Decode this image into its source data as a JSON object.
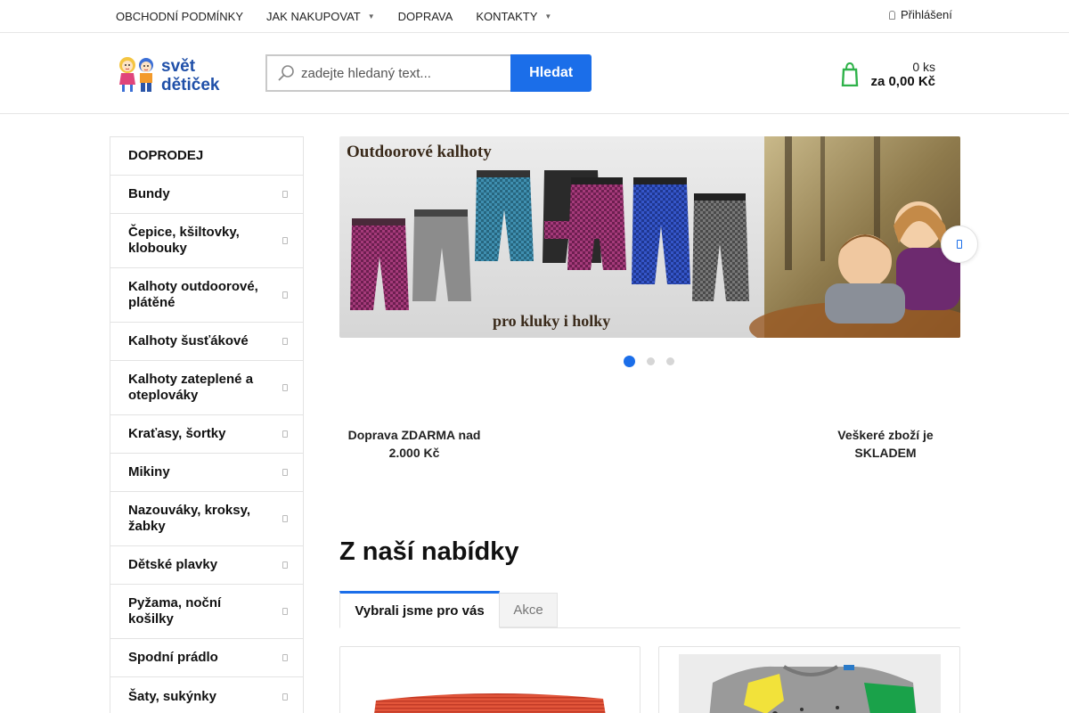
{
  "topnav": {
    "items": [
      {
        "label": "OBCHODNÍ PODMÍNKY",
        "dropdown": false
      },
      {
        "label": "JAK NAKUPOVAT",
        "dropdown": true
      },
      {
        "label": "DOPRAVA",
        "dropdown": false
      },
      {
        "label": "KONTAKTY",
        "dropdown": true
      }
    ],
    "login_label": "Přihlášení"
  },
  "logo": {
    "text_line1": "svět",
    "text_line2": "dětiček"
  },
  "search": {
    "placeholder": "zadejte hledaný text...",
    "button_label": "Hledat"
  },
  "cart": {
    "count": "0 ks",
    "total": "za 0,00 Kč",
    "accent": "#2fb24a"
  },
  "sidebar": {
    "items": [
      {
        "label": "DOPRODEJ"
      },
      {
        "label": "Bundy"
      },
      {
        "label": "Čepice, kšiltovky, klobouky"
      },
      {
        "label": "Kalhoty outdoorové, plátěné"
      },
      {
        "label": "Kalhoty šusťákové"
      },
      {
        "label": "Kalhoty zateplené a oteplováky"
      },
      {
        "label": "Kraťasy, šortky"
      },
      {
        "label": "Mikiny"
      },
      {
        "label": "Nazouváky, kroksy, žabky"
      },
      {
        "label": "Dětské plavky"
      },
      {
        "label": "Pyžama, noční košilky"
      },
      {
        "label": "Spodní prádlo"
      },
      {
        "label": "Šaty, sukýnky"
      }
    ]
  },
  "banner": {
    "title": "Outdoorové kalhoty",
    "subtitle": "pro kluky i holky",
    "slide_count": 3,
    "active_slide": 1
  },
  "benefits": {
    "left": {
      "line1": "Doprava ZDARMA nad",
      "line2": "2.000 Kč"
    },
    "right": {
      "line1": "Veškeré zboží je",
      "line2": "SKLADEM"
    }
  },
  "offer": {
    "title": "Z naší nabídky",
    "tabs": [
      {
        "label": "Vybrali jsme pro vás"
      },
      {
        "label": "Akce"
      }
    ]
  },
  "colors": {
    "accent": "#1b6ee9",
    "cart_green": "#2fb24a"
  }
}
